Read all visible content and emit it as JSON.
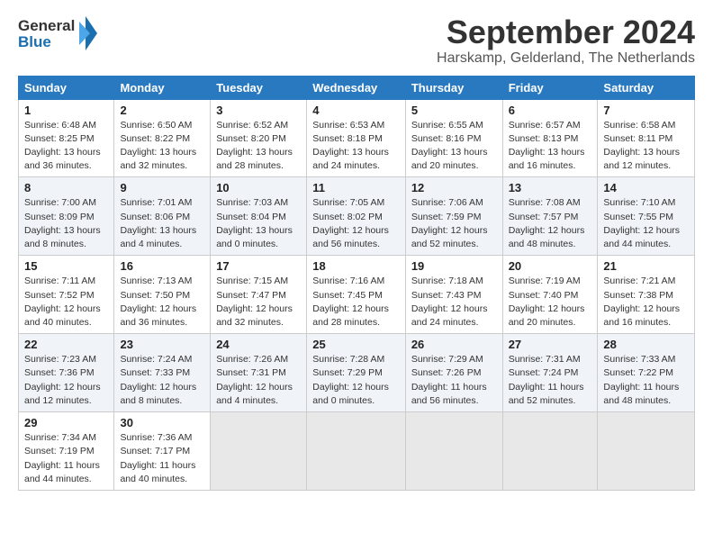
{
  "header": {
    "logo_general": "General",
    "logo_blue": "Blue",
    "title": "September 2024",
    "subtitle": "Harskamp, Gelderland, The Netherlands"
  },
  "weekdays": [
    "Sunday",
    "Monday",
    "Tuesday",
    "Wednesday",
    "Thursday",
    "Friday",
    "Saturday"
  ],
  "weeks": [
    [
      {
        "day": "1",
        "sunrise": "Sunrise: 6:48 AM",
        "sunset": "Sunset: 8:25 PM",
        "daylight": "Daylight: 13 hours and 36 minutes."
      },
      {
        "day": "2",
        "sunrise": "Sunrise: 6:50 AM",
        "sunset": "Sunset: 8:22 PM",
        "daylight": "Daylight: 13 hours and 32 minutes."
      },
      {
        "day": "3",
        "sunrise": "Sunrise: 6:52 AM",
        "sunset": "Sunset: 8:20 PM",
        "daylight": "Daylight: 13 hours and 28 minutes."
      },
      {
        "day": "4",
        "sunrise": "Sunrise: 6:53 AM",
        "sunset": "Sunset: 8:18 PM",
        "daylight": "Daylight: 13 hours and 24 minutes."
      },
      {
        "day": "5",
        "sunrise": "Sunrise: 6:55 AM",
        "sunset": "Sunset: 8:16 PM",
        "daylight": "Daylight: 13 hours and 20 minutes."
      },
      {
        "day": "6",
        "sunrise": "Sunrise: 6:57 AM",
        "sunset": "Sunset: 8:13 PM",
        "daylight": "Daylight: 13 hours and 16 minutes."
      },
      {
        "day": "7",
        "sunrise": "Sunrise: 6:58 AM",
        "sunset": "Sunset: 8:11 PM",
        "daylight": "Daylight: 13 hours and 12 minutes."
      }
    ],
    [
      {
        "day": "8",
        "sunrise": "Sunrise: 7:00 AM",
        "sunset": "Sunset: 8:09 PM",
        "daylight": "Daylight: 13 hours and 8 minutes."
      },
      {
        "day": "9",
        "sunrise": "Sunrise: 7:01 AM",
        "sunset": "Sunset: 8:06 PM",
        "daylight": "Daylight: 13 hours and 4 minutes."
      },
      {
        "day": "10",
        "sunrise": "Sunrise: 7:03 AM",
        "sunset": "Sunset: 8:04 PM",
        "daylight": "Daylight: 13 hours and 0 minutes."
      },
      {
        "day": "11",
        "sunrise": "Sunrise: 7:05 AM",
        "sunset": "Sunset: 8:02 PM",
        "daylight": "Daylight: 12 hours and 56 minutes."
      },
      {
        "day": "12",
        "sunrise": "Sunrise: 7:06 AM",
        "sunset": "Sunset: 7:59 PM",
        "daylight": "Daylight: 12 hours and 52 minutes."
      },
      {
        "day": "13",
        "sunrise": "Sunrise: 7:08 AM",
        "sunset": "Sunset: 7:57 PM",
        "daylight": "Daylight: 12 hours and 48 minutes."
      },
      {
        "day": "14",
        "sunrise": "Sunrise: 7:10 AM",
        "sunset": "Sunset: 7:55 PM",
        "daylight": "Daylight: 12 hours and 44 minutes."
      }
    ],
    [
      {
        "day": "15",
        "sunrise": "Sunrise: 7:11 AM",
        "sunset": "Sunset: 7:52 PM",
        "daylight": "Daylight: 12 hours and 40 minutes."
      },
      {
        "day": "16",
        "sunrise": "Sunrise: 7:13 AM",
        "sunset": "Sunset: 7:50 PM",
        "daylight": "Daylight: 12 hours and 36 minutes."
      },
      {
        "day": "17",
        "sunrise": "Sunrise: 7:15 AM",
        "sunset": "Sunset: 7:47 PM",
        "daylight": "Daylight: 12 hours and 32 minutes."
      },
      {
        "day": "18",
        "sunrise": "Sunrise: 7:16 AM",
        "sunset": "Sunset: 7:45 PM",
        "daylight": "Daylight: 12 hours and 28 minutes."
      },
      {
        "day": "19",
        "sunrise": "Sunrise: 7:18 AM",
        "sunset": "Sunset: 7:43 PM",
        "daylight": "Daylight: 12 hours and 24 minutes."
      },
      {
        "day": "20",
        "sunrise": "Sunrise: 7:19 AM",
        "sunset": "Sunset: 7:40 PM",
        "daylight": "Daylight: 12 hours and 20 minutes."
      },
      {
        "day": "21",
        "sunrise": "Sunrise: 7:21 AM",
        "sunset": "Sunset: 7:38 PM",
        "daylight": "Daylight: 12 hours and 16 minutes."
      }
    ],
    [
      {
        "day": "22",
        "sunrise": "Sunrise: 7:23 AM",
        "sunset": "Sunset: 7:36 PM",
        "daylight": "Daylight: 12 hours and 12 minutes."
      },
      {
        "day": "23",
        "sunrise": "Sunrise: 7:24 AM",
        "sunset": "Sunset: 7:33 PM",
        "daylight": "Daylight: 12 hours and 8 minutes."
      },
      {
        "day": "24",
        "sunrise": "Sunrise: 7:26 AM",
        "sunset": "Sunset: 7:31 PM",
        "daylight": "Daylight: 12 hours and 4 minutes."
      },
      {
        "day": "25",
        "sunrise": "Sunrise: 7:28 AM",
        "sunset": "Sunset: 7:29 PM",
        "daylight": "Daylight: 12 hours and 0 minutes."
      },
      {
        "day": "26",
        "sunrise": "Sunrise: 7:29 AM",
        "sunset": "Sunset: 7:26 PM",
        "daylight": "Daylight: 11 hours and 56 minutes."
      },
      {
        "day": "27",
        "sunrise": "Sunrise: 7:31 AM",
        "sunset": "Sunset: 7:24 PM",
        "daylight": "Daylight: 11 hours and 52 minutes."
      },
      {
        "day": "28",
        "sunrise": "Sunrise: 7:33 AM",
        "sunset": "Sunset: 7:22 PM",
        "daylight": "Daylight: 11 hours and 48 minutes."
      }
    ],
    [
      {
        "day": "29",
        "sunrise": "Sunrise: 7:34 AM",
        "sunset": "Sunset: 7:19 PM",
        "daylight": "Daylight: 11 hours and 44 minutes."
      },
      {
        "day": "30",
        "sunrise": "Sunrise: 7:36 AM",
        "sunset": "Sunset: 7:17 PM",
        "daylight": "Daylight: 11 hours and 40 minutes."
      },
      null,
      null,
      null,
      null,
      null
    ]
  ]
}
